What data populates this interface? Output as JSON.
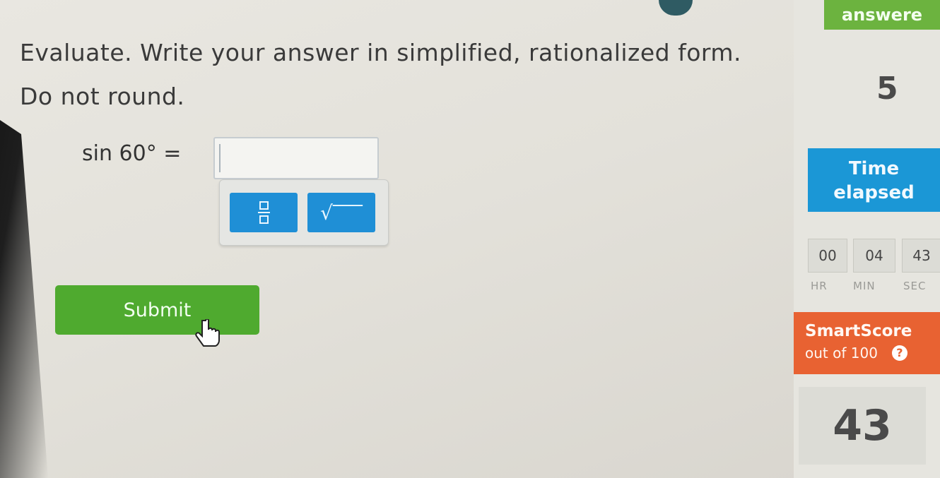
{
  "question": {
    "line1": "Evaluate. Write your answer in simplified, rationalized form.",
    "line2": "Do not round.",
    "equation": "sin 60° =",
    "answer_value": ""
  },
  "math_toolbar": {
    "fraction_icon": "fraction-icon",
    "sqrt_symbol": "√‾‾‾"
  },
  "submit_label": "Submit",
  "sidebar": {
    "answered_label": "answere",
    "answered_count": "5",
    "time_label_line1": "Time",
    "time_label_line2": "elapsed",
    "time": {
      "hr": "00",
      "min": "04",
      "sec": "43"
    },
    "time_units": {
      "hr": "HR",
      "min": "MIN",
      "sec": "SEC"
    },
    "smartscore_title": "SmartScore",
    "smartscore_sub": "out of 100",
    "smartscore_help": "?",
    "smartscore_value": "43"
  },
  "colors": {
    "submit": "#4faa2f",
    "toolbar_button": "#1f8fd6",
    "time_header": "#1b97d6",
    "smartscore_header": "#e86232",
    "answered_header": "#6cb33f"
  }
}
